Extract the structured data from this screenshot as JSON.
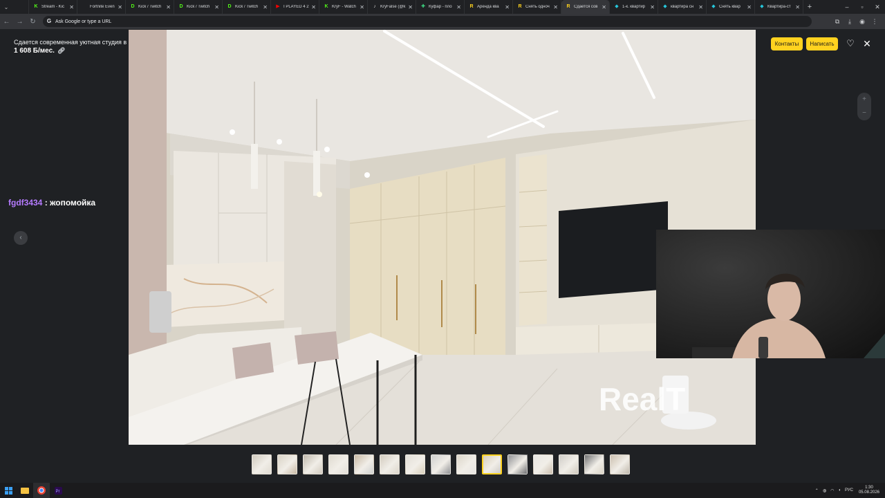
{
  "browser": {
    "tabs": [
      {
        "label": "",
        "favicon_color": "#e53935",
        "favicon_glyph": "",
        "active": false
      },
      {
        "label": "Stream - Kic",
        "favicon_color": "#53fc18",
        "favicon_glyph": "K",
        "active": false
      },
      {
        "label": "Fortnite Even",
        "favicon_color": "#9e9e9e",
        "favicon_glyph": "",
        "active": false
      },
      {
        "label": "Kick / Twitch",
        "favicon_color": "#53fc18",
        "favicon_glyph": "D",
        "active": false
      },
      {
        "label": "Kick / Twitch",
        "favicon_color": "#53fc18",
        "favicon_glyph": "D",
        "active": false
      },
      {
        "label": "Kick / Twitch",
        "favicon_color": "#53fc18",
        "favicon_glyph": "D",
        "active": false
      },
      {
        "label": "I PLAYED 4 2",
        "favicon_color": "#ff0000",
        "favicon_glyph": "▶",
        "active": false
      },
      {
        "label": "KryF - Watch",
        "favicon_color": "#53fc18",
        "favicon_glyph": "K",
        "active": false
      },
      {
        "label": "KryFalse (@k",
        "favicon_color": "#cccccc",
        "favicon_glyph": "♪",
        "active": false
      },
      {
        "label": "Куфар - пло",
        "favicon_color": "#3ddc84",
        "favicon_glyph": "✚",
        "active": false
      },
      {
        "label": "Аренда ква",
        "favicon_color": "#ffd21f",
        "favicon_glyph": "R",
        "active": false
      },
      {
        "label": "Снять одноч",
        "favicon_color": "#ffd21f",
        "favicon_glyph": "R",
        "active": false
      },
      {
        "label": "Сдается сов",
        "favicon_color": "#ffd21f",
        "favicon_glyph": "R",
        "active": true
      },
      {
        "label": "1-к. квартир",
        "favicon_color": "#26c6da",
        "favicon_glyph": "◆",
        "active": false
      },
      {
        "label": "квартира сн",
        "favicon_color": "#26c6da",
        "favicon_glyph": "◆",
        "active": false
      },
      {
        "label": "Снять квар",
        "favicon_color": "#26c6da",
        "favicon_glyph": "◆",
        "active": false
      },
      {
        "label": "Квартира-ст",
        "favicon_color": "#26c6da",
        "favicon_glyph": "◆",
        "active": false
      }
    ],
    "omnibox_placeholder": "Ask Google or type a URL"
  },
  "listing": {
    "title": "Сдается современная уютная студия в Минск Мире",
    "price": "1 608 Б/мес."
  },
  "actions": {
    "contacts_label": "Контакты",
    "write_label": "Написать"
  },
  "chat": {
    "username": "fgdf3434",
    "separator": " : ",
    "message": "жопомойка"
  },
  "photo": {
    "watermark": "RealT",
    "thumbnail_count": 15,
    "active_thumbnail_index": 9
  },
  "taskbar": {
    "language": "РУС",
    "time": "1:30",
    "date": "05.08.2026"
  }
}
